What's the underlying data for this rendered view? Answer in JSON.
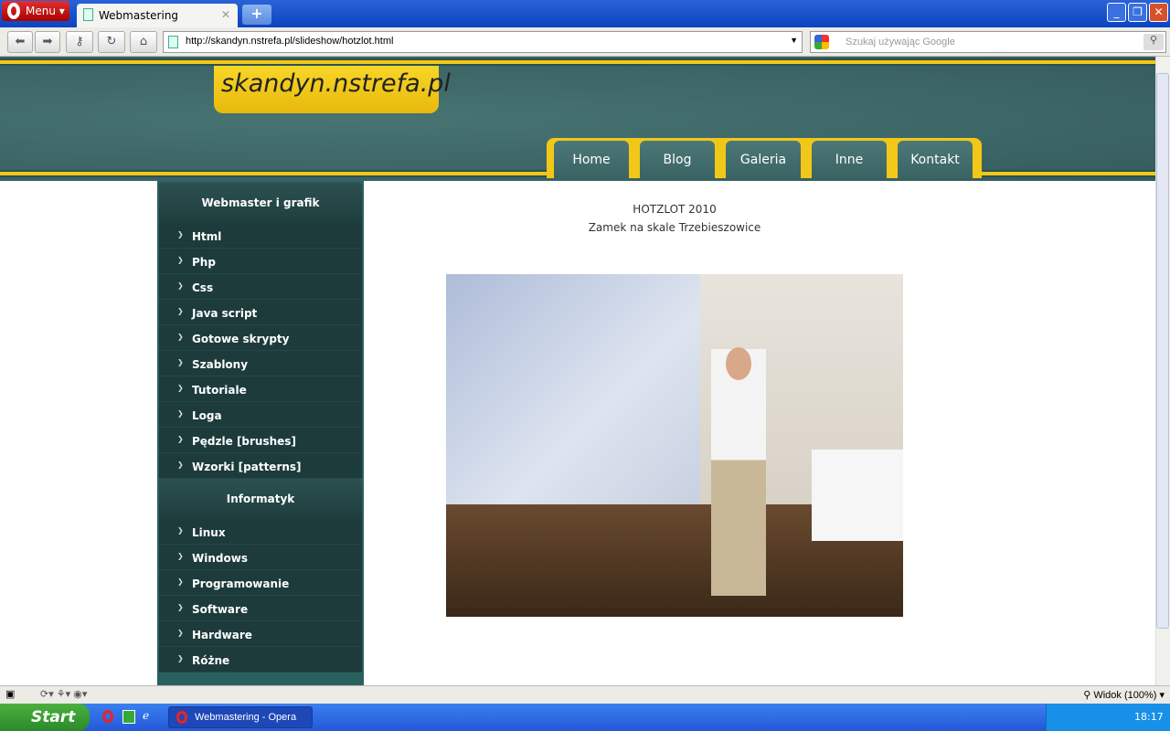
{
  "browser": {
    "menu_label": "Menu",
    "tab_title": "Webmastering",
    "url": "http://skandyn.nstrefa.pl/slideshow/hotzlot.html",
    "search_placeholder": "Szukaj używając Google",
    "zoom_label": "Widok (100%)"
  },
  "site": {
    "logo": "skandyn.nstrefa.pl",
    "nav": [
      "Home",
      "Blog",
      "Galeria",
      "Inne",
      "Kontakt"
    ],
    "sidebar": [
      {
        "title": "Webmaster i grafik",
        "items": [
          "Html",
          "Php",
          "Css",
          "Java script",
          "Gotowe skrypty",
          "Szablony",
          "Tutoriale",
          "Loga",
          "Pędzle [brushes]",
          "Wzorki [patterns]"
        ]
      },
      {
        "title": "Informatyk",
        "items": [
          "Linux",
          "Windows",
          "Programowanie",
          "Software",
          "Hardware",
          "Różne"
        ]
      }
    ],
    "main": {
      "title": "HOTZLOT 2010",
      "subtitle": "Zamek na skale Trzebieszowice"
    }
  },
  "taskbar": {
    "start": "Start",
    "task": "Webmastering - Opera",
    "clock": "18:17"
  },
  "colors": {
    "header": "#3d6464",
    "accent": "#f2c818",
    "sidebar": "#1d3b3b"
  }
}
